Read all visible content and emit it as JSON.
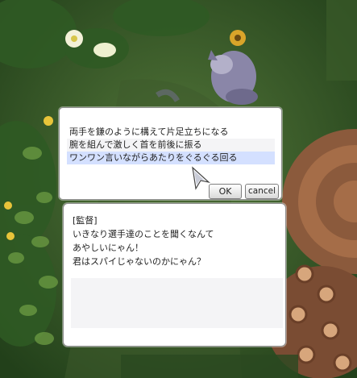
{
  "menu": {
    "options": [
      "両手を鎌のように構えて片足立ちになる",
      "腕を組んで激しく首を前後に振る",
      "ワンワン言いながらあたりをぐるぐる回る"
    ],
    "selected_index": 2,
    "ok_label": "OK",
    "cancel_label": "cancel"
  },
  "dialog": {
    "lines": [
      "[監督]",
      "いきなり選手達のことを聞くなんて",
      "あやしいにゃん！",
      "君はスパイじゃないのかにゃん？"
    ]
  },
  "colors": {
    "window_bg": "#ffffff",
    "selected_row": "#d4e0ff",
    "alt_row": "#f4f4f6",
    "text": "#222222"
  }
}
